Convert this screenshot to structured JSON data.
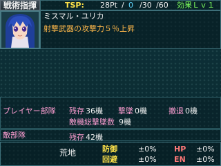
{
  "header": {
    "title": "戦術指揮",
    "tsp_label": "TSP:",
    "tsp_value": "28Pt",
    "tsp_current": "0",
    "tsp_limit": "/30",
    "tsp_max": "/60",
    "effect_level": "効果Ｌｖ１"
  },
  "pilot": {
    "name": "ミスマル・ユリカ",
    "skill_description": "射撃武器の攻撃力５％上昇"
  },
  "player_units": {
    "label": "プレイヤー部隊",
    "remaining_label": "残存",
    "remaining_value": "36機",
    "shot_down_label": "撃墜",
    "shot_down_value": "0機",
    "retreat_label": "撤退",
    "retreat_value": "0機",
    "total_kills_label": "敵機総撃墜数",
    "total_kills_value": "9機"
  },
  "enemy_units": {
    "label": "敵部隊",
    "remaining_label": "残存",
    "remaining_value": "42機"
  },
  "terrain": {
    "name": "荒地",
    "defense_label": "防御",
    "defense_value": "±0%",
    "evasion_label": "回避",
    "evasion_value": "±0%",
    "hp_label": "HP",
    "hp_value": "±0%",
    "en_label": "EN",
    "en_value": "±0%"
  }
}
